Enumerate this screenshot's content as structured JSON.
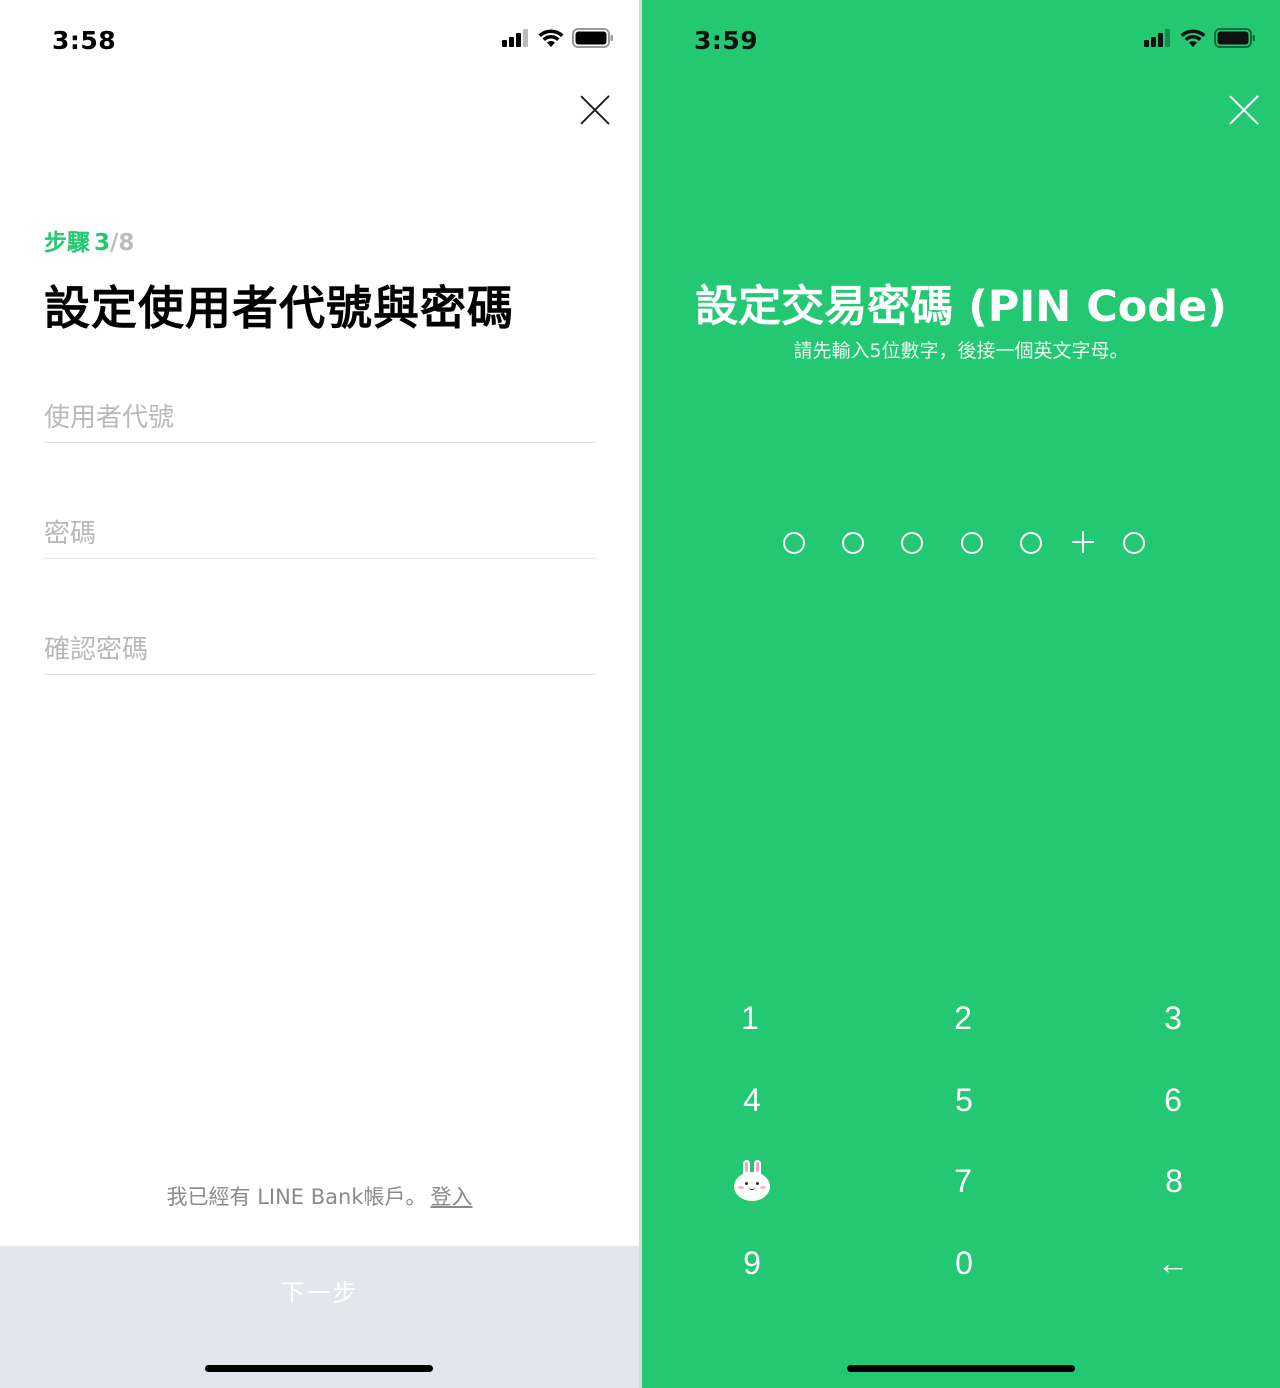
{
  "left_screen": {
    "status_time": "3:58",
    "step": {
      "label": "步驟",
      "current": "3",
      "total": "/8"
    },
    "title": "設定使用者代號與密碼",
    "fields": {
      "user_id_placeholder": "使用者代號",
      "password_placeholder": "密碼",
      "confirm_password_placeholder": "確認密碼"
    },
    "login_prompt": "我已經有 LINE Bank帳戶。",
    "login_link": "登入",
    "next_button": "下一步"
  },
  "right_screen": {
    "status_time": "3:59",
    "title": "設定交易密碼 (PIN Code)",
    "subtitle": "請先輸入5位數字，後接一個英文字母。",
    "keypad": [
      "1",
      "2",
      "3",
      "4",
      "5",
      "6",
      "7",
      "8",
      "9",
      "0"
    ],
    "backspace_glyph": "←"
  },
  "colors": {
    "brand_green": "#25c872",
    "button_disabled": "#e3e6eb"
  },
  "icons": [
    "signal-icon",
    "wifi-icon",
    "battery-icon",
    "close-icon",
    "bunny-icon",
    "backspace-icon"
  ]
}
